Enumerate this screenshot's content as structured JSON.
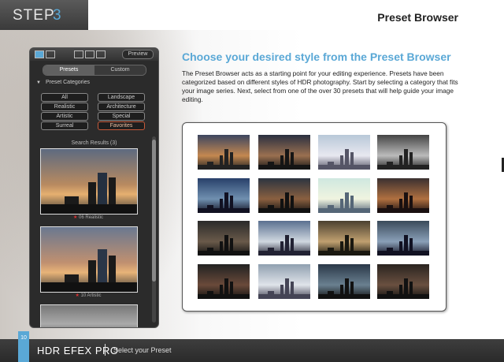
{
  "header": {
    "step_label": "STEP",
    "step_number": "3",
    "page_title": "Preset Browser"
  },
  "panel": {
    "preview_button": "Preview",
    "tabs": [
      {
        "label": "Presets",
        "active": true
      },
      {
        "label": "Custom",
        "active": false
      }
    ],
    "categories_header": "Preset Categories",
    "categories": [
      {
        "label": "All",
        "active": false
      },
      {
        "label": "Landscape",
        "active": false
      },
      {
        "label": "Realistic",
        "active": false
      },
      {
        "label": "Architecture",
        "active": false
      },
      {
        "label": "Artistic",
        "active": false
      },
      {
        "label": "Special",
        "active": false
      },
      {
        "label": "Surreal",
        "active": false
      },
      {
        "label": "Favorites",
        "active": true
      }
    ],
    "search_results_label": "Search Results (3)",
    "results": [
      {
        "caption": "06 Realistic"
      },
      {
        "caption": "10 Artistic"
      },
      {
        "caption": ""
      }
    ]
  },
  "content": {
    "heading": "Choose your desired style from the Preset Browser",
    "body": "The Preset Browser acts as a starting point for your editing experience. Presets have been categorized based on different styles of HDR photography. Start by selecting a category that fits your image series. Next, select from one of the over 30 presets that will help guide your image editing."
  },
  "footer": {
    "page_number": "10",
    "brand": "HDR EFEX PRO",
    "section": "Select your Preset"
  },
  "colors": {
    "accent": "#5aa8d6",
    "favorites_border": "#c65a3a"
  }
}
